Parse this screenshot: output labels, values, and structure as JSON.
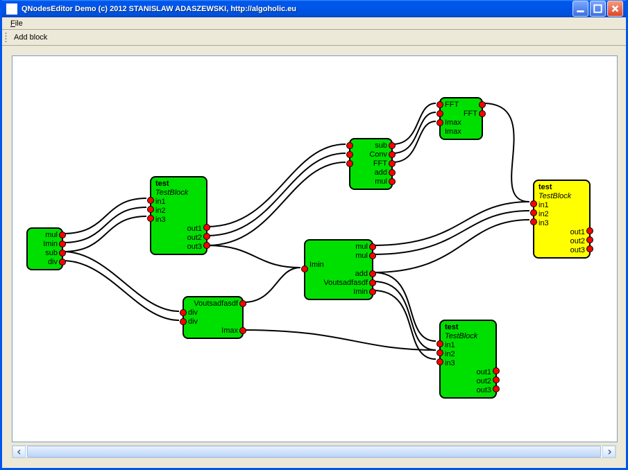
{
  "window": {
    "title": "QNodesEditor Demo (c) 2012 STANISLAW ADASZEWSKI, http://algoholic.eu"
  },
  "menu": {
    "file": "File"
  },
  "toolbar": {
    "add_block": "Add block"
  },
  "nodes": {
    "n1": {
      "ports_left": [
        "mul",
        "Imin",
        "sub",
        "div"
      ]
    },
    "n2": {
      "title": "test",
      "subtitle": "TestBlock",
      "inputs": [
        "in1",
        "in2",
        "in3"
      ],
      "outputs": [
        "out1",
        "out2",
        "out3"
      ]
    },
    "n3": {
      "ports_right": [
        "sub",
        "Conv",
        "FFT",
        "add",
        "mul"
      ]
    },
    "n4": {
      "ports": [
        "FFT",
        "FFT",
        "Imax",
        "Imax"
      ]
    },
    "n5": {
      "ports_right": [
        "Voutsadfasdf",
        "div",
        "div",
        "Imax"
      ]
    },
    "n6": {
      "ports_left_in": [
        "Imin"
      ],
      "ports_right": [
        "mul",
        "mul",
        "",
        "add",
        "Voutsadfasdf",
        "Imin"
      ]
    },
    "n7": {
      "title": "test",
      "subtitle": "TestBlock",
      "inputs": [
        "in1",
        "in2",
        "in3"
      ],
      "outputs": [
        "out1",
        "out2",
        "out3"
      ]
    },
    "n8": {
      "title": "test",
      "subtitle": "TestBlock",
      "inputs": [
        "in1",
        "in2",
        "in3"
      ],
      "outputs": [
        "out1",
        "out2",
        "out3"
      ]
    }
  }
}
